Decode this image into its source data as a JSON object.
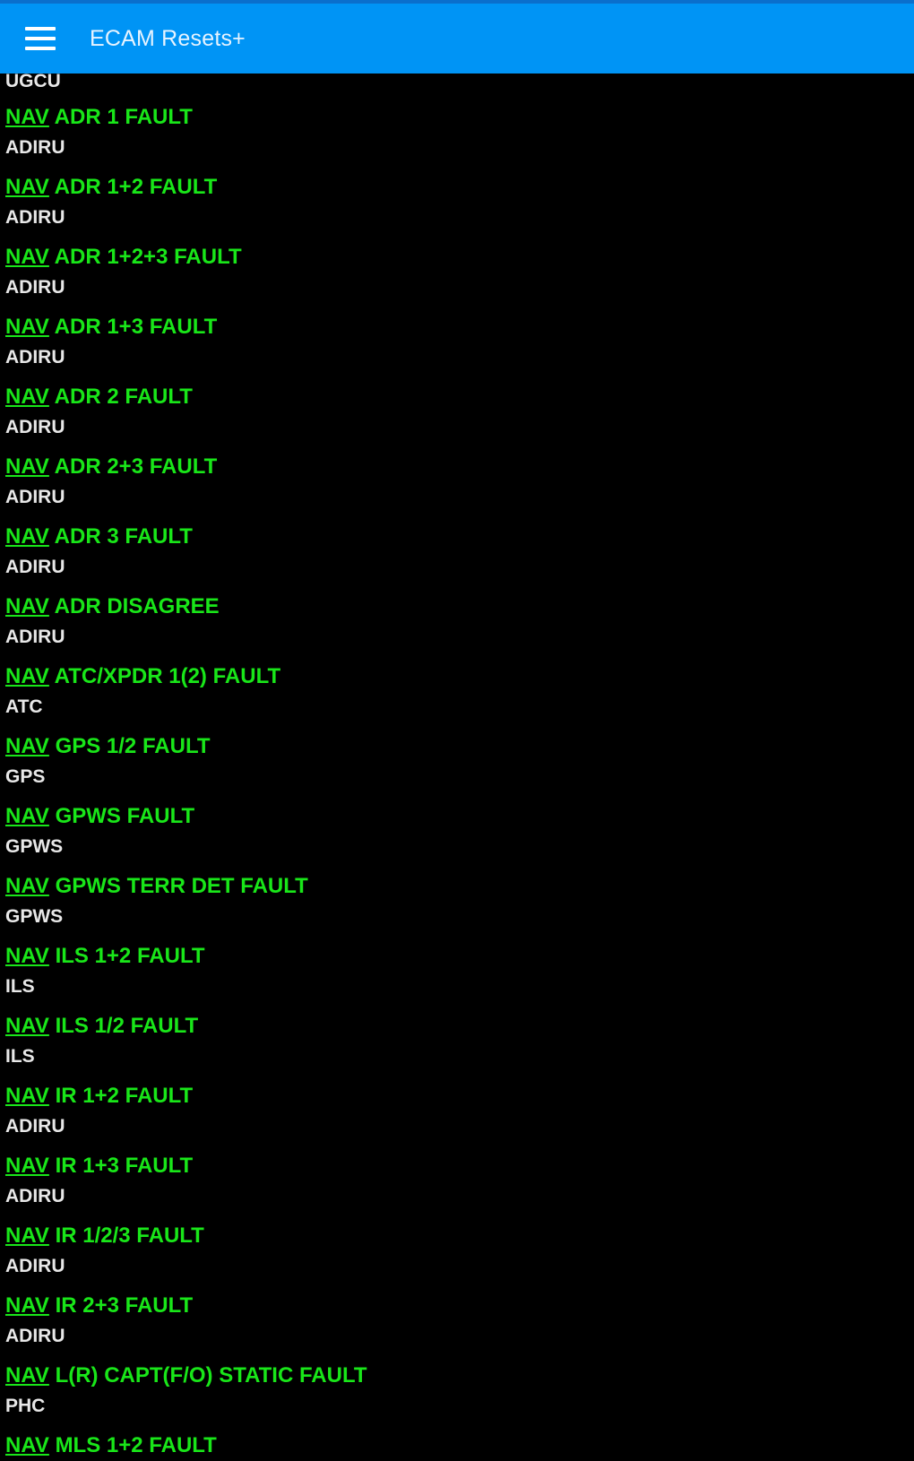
{
  "app": {
    "title": "ECAM Resets+",
    "header_color": "#0094f5",
    "menu_icon": "hamburger-menu-icon"
  },
  "colors": {
    "title_green": "#19e619",
    "subtitle_white": "#e8e8e8",
    "background": "#000000"
  },
  "list": {
    "partial_top_subtitle": "UGCU",
    "items": [
      {
        "category": "NAV",
        "title": "ADR 1 FAULT",
        "subtitle": "ADIRU"
      },
      {
        "category": "NAV",
        "title": "ADR 1+2 FAULT",
        "subtitle": "ADIRU"
      },
      {
        "category": "NAV",
        "title": "ADR 1+2+3 FAULT",
        "subtitle": "ADIRU"
      },
      {
        "category": "NAV",
        "title": "ADR 1+3 FAULT",
        "subtitle": "ADIRU"
      },
      {
        "category": "NAV",
        "title": "ADR 2 FAULT",
        "subtitle": "ADIRU"
      },
      {
        "category": "NAV",
        "title": "ADR 2+3 FAULT",
        "subtitle": "ADIRU"
      },
      {
        "category": "NAV",
        "title": "ADR 3 FAULT",
        "subtitle": "ADIRU"
      },
      {
        "category": "NAV",
        "title": "ADR DISAGREE",
        "subtitle": "ADIRU"
      },
      {
        "category": "NAV",
        "title": "ATC/XPDR 1(2) FAULT",
        "subtitle": "ATC"
      },
      {
        "category": "NAV",
        "title": "GPS 1/2 FAULT",
        "subtitle": "GPS"
      },
      {
        "category": "NAV",
        "title": "GPWS FAULT",
        "subtitle": "GPWS"
      },
      {
        "category": "NAV",
        "title": "GPWS TERR DET FAULT",
        "subtitle": "GPWS"
      },
      {
        "category": "NAV",
        "title": "ILS 1+2 FAULT",
        "subtitle": "ILS"
      },
      {
        "category": "NAV",
        "title": "ILS 1/2 FAULT",
        "subtitle": "ILS"
      },
      {
        "category": "NAV",
        "title": "IR 1+2 FAULT",
        "subtitle": "ADIRU"
      },
      {
        "category": "NAV",
        "title": "IR 1+3 FAULT",
        "subtitle": "ADIRU"
      },
      {
        "category": "NAV",
        "title": "IR 1/2/3 FAULT",
        "subtitle": "ADIRU"
      },
      {
        "category": "NAV",
        "title": "IR 2+3 FAULT",
        "subtitle": "ADIRU"
      },
      {
        "category": "NAV",
        "title": "L(R) CAPT(F/O) STATIC FAULT",
        "subtitle": "PHC"
      },
      {
        "category": "NAV",
        "title": "MLS 1+2 FAULT",
        "subtitle": ""
      }
    ]
  }
}
